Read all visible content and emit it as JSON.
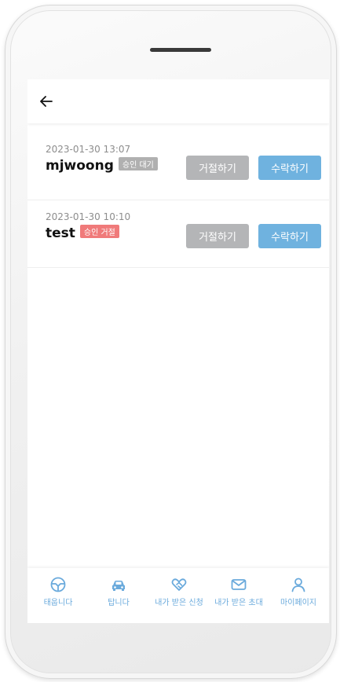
{
  "requests": [
    {
      "datetime": "2023-01-30 13:07",
      "name": "mjwoong",
      "status": "승인 대기",
      "status_type": "pending",
      "reject_label": "거절하기",
      "accept_label": "수락하기"
    },
    {
      "datetime": "2023-01-30 10:10",
      "name": "test",
      "status": "승인 거절",
      "status_type": "rejected",
      "reject_label": "거절하기",
      "accept_label": "수락하기"
    }
  ],
  "tabbar": {
    "items": [
      {
        "label": "태웁니다",
        "icon": "steering-wheel-icon"
      },
      {
        "label": "탑니다",
        "icon": "car-icon"
      },
      {
        "label": "내가 받은 신청",
        "icon": "heart-handshake-icon"
      },
      {
        "label": "내가 받은 초대",
        "icon": "envelope-icon"
      },
      {
        "label": "마이페이지",
        "icon": "person-icon"
      }
    ]
  },
  "colors": {
    "accent": "#6fb2df",
    "reject_button": "#b4b5b7",
    "badge_pending": "#b0b0b0",
    "badge_rejected": "#f07a7a"
  }
}
